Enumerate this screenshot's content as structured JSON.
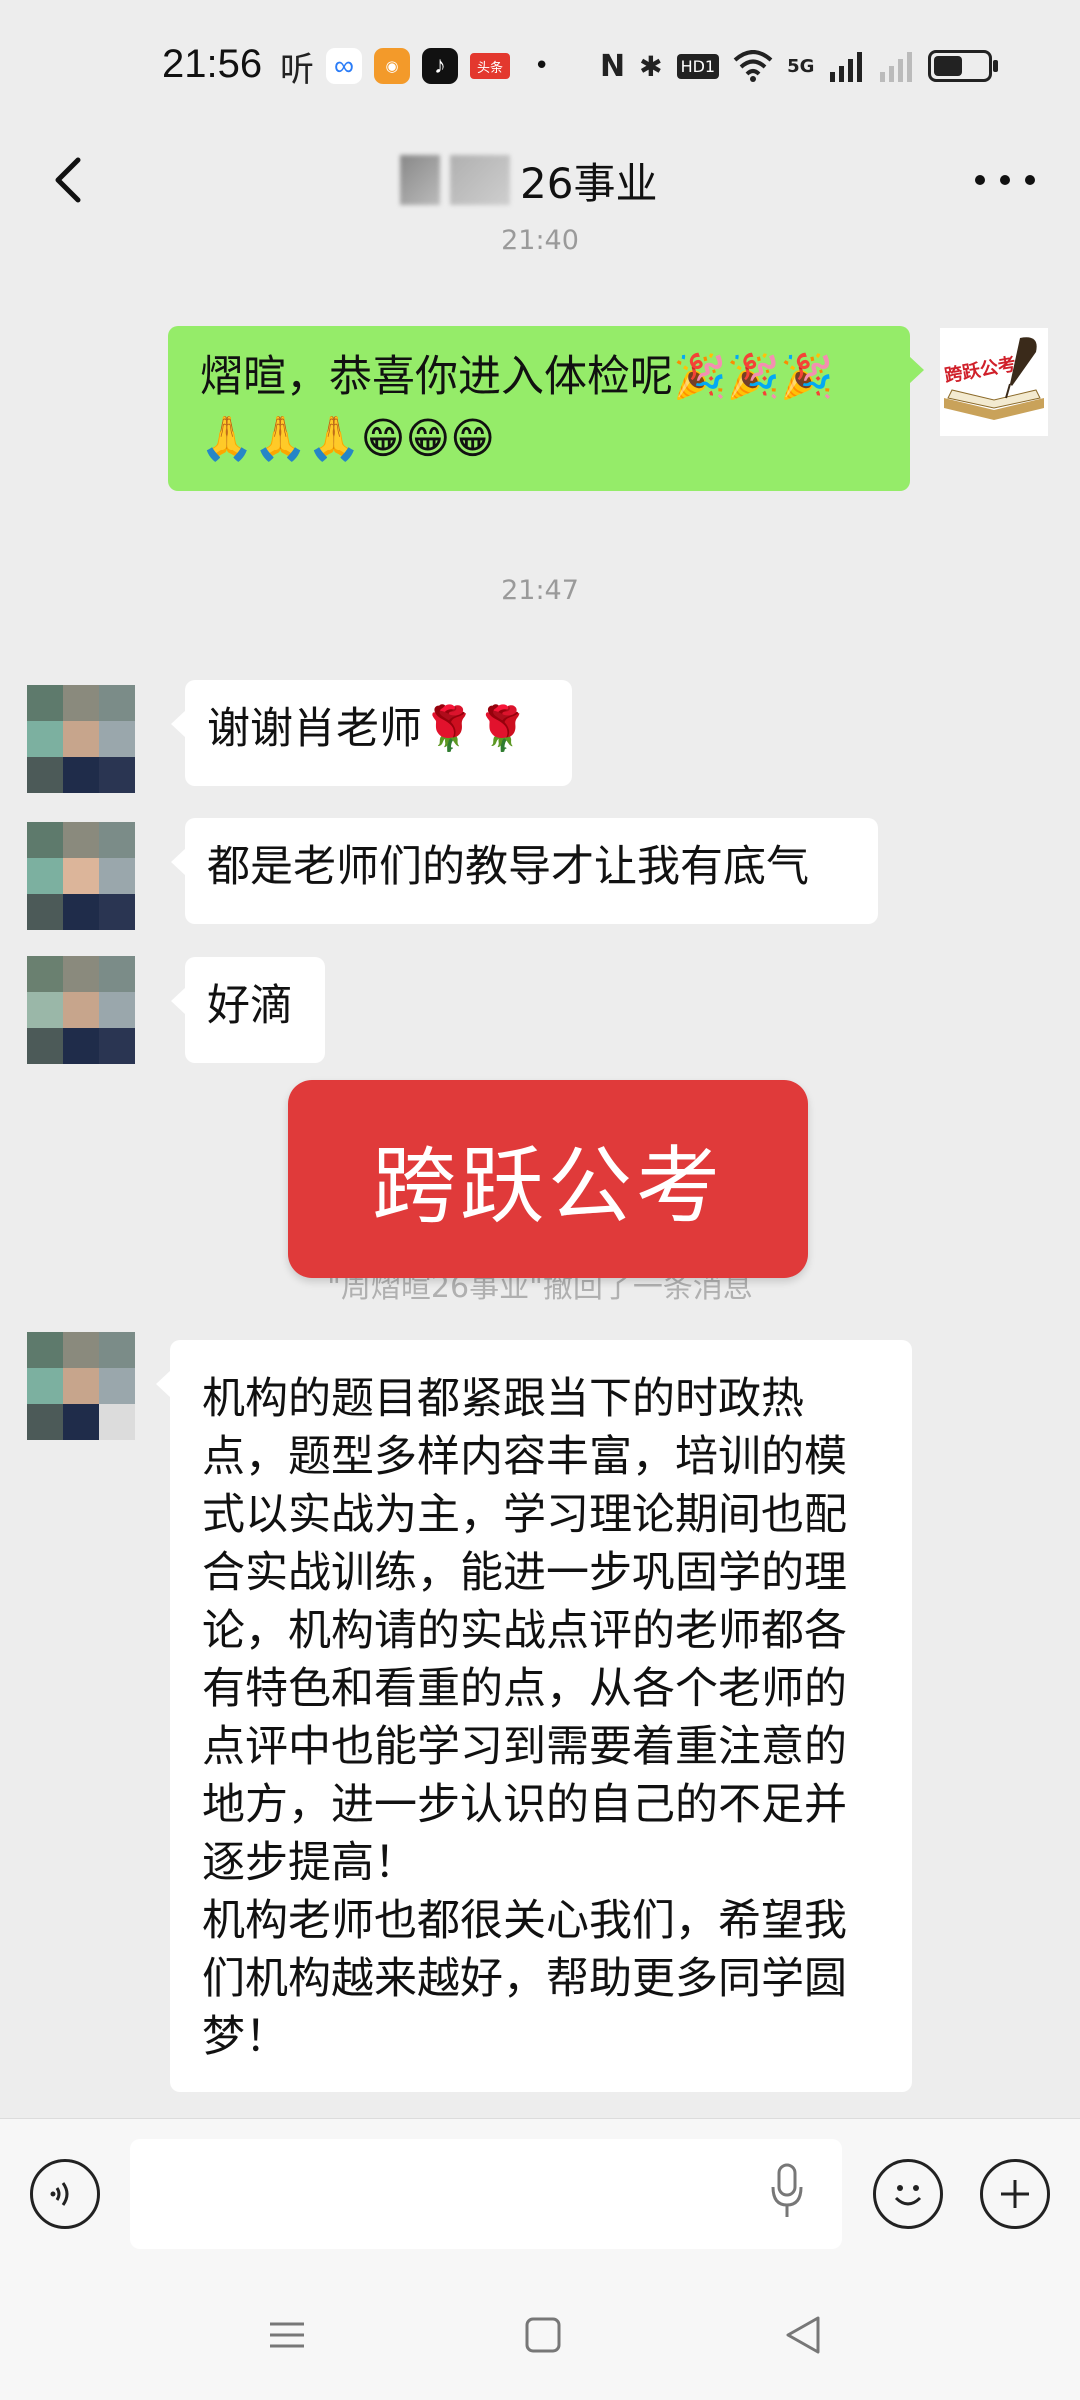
{
  "status_bar": {
    "time": "21:56",
    "app_icons": [
      "听",
      "∞",
      "◉",
      "♪",
      "头条"
    ],
    "right_icons": [
      "•",
      "N",
      "✱",
      "HD1",
      "wifi",
      "5G",
      "signal",
      "battery"
    ],
    "hd_label": "HD1",
    "net_label": "5G"
  },
  "header": {
    "back_icon": "chevron-left-icon",
    "title": "26事业",
    "more_icon": "more-dots-icon"
  },
  "chat": {
    "partial_time": "21:40",
    "outgoing_1": {
      "line1": "熠暄，恭喜你进入体检呢🎉🎉🎉",
      "line2": "🙏🙏🙏😁😁😁"
    },
    "my_avatar_text": "跨跃公考",
    "time_2": "21:47",
    "incoming_1": "谢谢肖老师🌹🌹",
    "incoming_2": "都是老师们的教导才让我有底气",
    "incoming_3": "好滴",
    "recall_notice": "\"周熠暄26事业\"撤回了一条消息",
    "banner": "跨跃公考",
    "incoming_4_lines": [
      "机构的题目都紧跟当下的时政热",
      "点，题型多样内容丰富，培训的模",
      "式以实战为主，学习理论期间也配",
      "合实战训练，能进一步巩固学的理",
      "论，机构请的实战点评的老师都各",
      "有特色和看重的点，从各个老师的",
      "点评中也能学习到需要着重注意的",
      "地方，进一步认识的自己的不足并",
      "逐步提高！",
      "机构老师也都很关心我们，希望我",
      "们机构越来越好，帮助更多同学圆",
      "梦！"
    ]
  },
  "input_bar": {
    "voice_icon": "voice-icon",
    "mic_icon": "mic-icon",
    "emoji_icon": "emoji-icon",
    "plus_icon": "plus-icon"
  },
  "nav_bar": {
    "menu_icon": "menu-icon",
    "home_icon": "home-square-icon",
    "back_icon": "back-triangle-icon"
  },
  "colors": {
    "background": "#ededed",
    "outgoing_bubble": "#95ec69",
    "incoming_bubble": "#ffffff",
    "banner": "#e03a3a"
  }
}
